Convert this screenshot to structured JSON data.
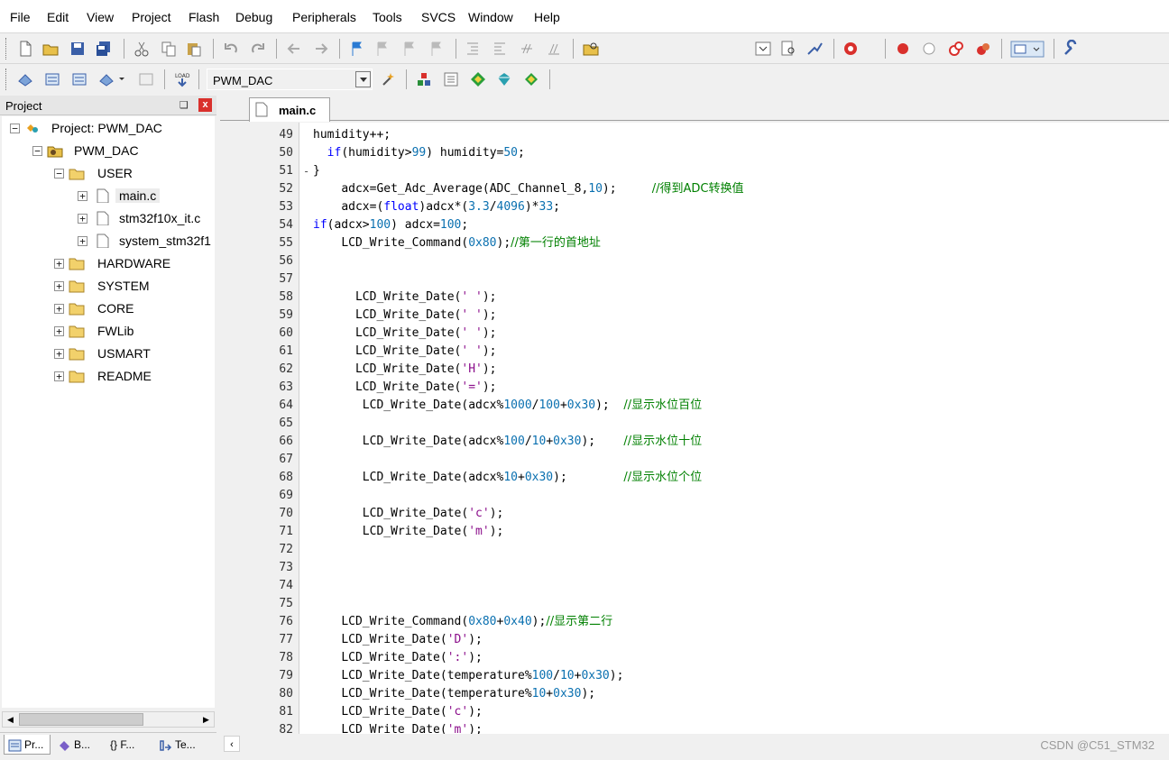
{
  "menu": [
    "File",
    "Edit",
    "View",
    "Project",
    "Flash",
    "Debug",
    "Peripherals",
    "Tools",
    "SVCS",
    "Window",
    "Help"
  ],
  "toolbar": {
    "target_name": "PWM_DAC",
    "load_label": "LOAD"
  },
  "project_panel": {
    "title": "Project",
    "pin_glyph": "❑",
    "close_glyph": "x",
    "tree": [
      {
        "label": "Project: PWM_DAC",
        "expander": "−"
      },
      {
        "label": "PWM_DAC",
        "expander": "−"
      },
      {
        "label": "USER",
        "expander": "−"
      },
      {
        "label": "main.c",
        "expander": "+"
      },
      {
        "label": "stm32f10x_it.c",
        "expander": "+"
      },
      {
        "label": "system_stm32f1",
        "expander": "+"
      },
      {
        "label": "HARDWARE",
        "expander": "+"
      },
      {
        "label": "SYSTEM",
        "expander": "+"
      },
      {
        "label": "CORE",
        "expander": "+"
      },
      {
        "label": "FWLib",
        "expander": "+"
      },
      {
        "label": "USMART",
        "expander": "+"
      },
      {
        "label": "README",
        "expander": "+"
      }
    ],
    "bottom_tabs": [
      "Pr...",
      "B...",
      "{} F...",
      "Te..."
    ]
  },
  "editor": {
    "active_tab": "main.c",
    "watermark": "CSDN @C51_STM32",
    "lines": [
      {
        "n": "49",
        "code": "humidity++;"
      },
      {
        "n": "50",
        "code": "  if(humidity>99) humidity=50;"
      },
      {
        "n": "51",
        "code": "}"
      },
      {
        "n": "52",
        "code": "    adcx=Get_Adc_Average(ADC_Channel_8,10);     //得到ADC转换值"
      },
      {
        "n": "53",
        "code": "    adcx=(float)adcx*(3.3/4096)*33;"
      },
      {
        "n": "54",
        "code": "if(adcx>100) adcx=100;"
      },
      {
        "n": "55",
        "code": "    LCD_Write_Command(0x80);//第一行的首地址"
      },
      {
        "n": "56",
        "code": ""
      },
      {
        "n": "57",
        "code": ""
      },
      {
        "n": "58",
        "code": "      LCD_Write_Date(' ');"
      },
      {
        "n": "59",
        "code": "      LCD_Write_Date(' ');"
      },
      {
        "n": "60",
        "code": "      LCD_Write_Date(' ');"
      },
      {
        "n": "61",
        "code": "      LCD_Write_Date(' ');"
      },
      {
        "n": "62",
        "code": "      LCD_Write_Date('H');"
      },
      {
        "n": "63",
        "code": "      LCD_Write_Date('=');"
      },
      {
        "n": "64",
        "code": "       LCD_Write_Date(adcx%1000/100+0x30);  //显示水位百位"
      },
      {
        "n": "65",
        "code": ""
      },
      {
        "n": "66",
        "code": "       LCD_Write_Date(adcx%100/10+0x30);    //显示水位十位"
      },
      {
        "n": "67",
        "code": ""
      },
      {
        "n": "68",
        "code": "       LCD_Write_Date(adcx%10+0x30);        //显示水位个位"
      },
      {
        "n": "69",
        "code": ""
      },
      {
        "n": "70",
        "code": "       LCD_Write_Date('c');"
      },
      {
        "n": "71",
        "code": "       LCD_Write_Date('m');"
      },
      {
        "n": "72",
        "code": ""
      },
      {
        "n": "73",
        "code": ""
      },
      {
        "n": "74",
        "code": ""
      },
      {
        "n": "75",
        "code": ""
      },
      {
        "n": "76",
        "code": "    LCD_Write_Command(0x80+0x40);//显示第二行"
      },
      {
        "n": "77",
        "code": "    LCD_Write_Date('D');"
      },
      {
        "n": "78",
        "code": "    LCD_Write_Date(':');"
      },
      {
        "n": "79",
        "code": "    LCD_Write_Date(temperature%100/10+0x30);"
      },
      {
        "n": "80",
        "code": "    LCD_Write_Date(temperature%10+0x30);"
      },
      {
        "n": "81",
        "code": "    LCD_Write_Date('c');"
      },
      {
        "n": "82",
        "code": "    LCD_Write_Date('m');"
      }
    ]
  },
  "colors": {
    "comment": "#008000",
    "number": "#0a70b0",
    "keyword": "#0000ff",
    "string": "#8a0c8a"
  }
}
